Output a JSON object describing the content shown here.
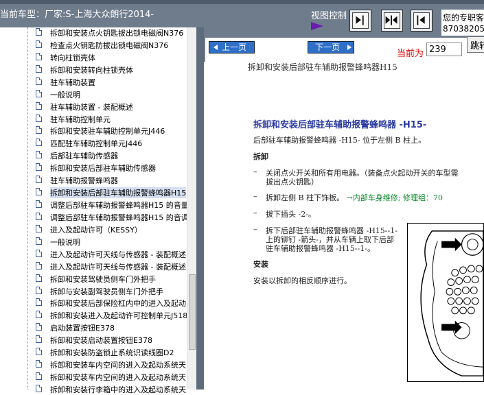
{
  "header": {
    "car_model": "当前车型：厂家:S-上海大众朗行2014-",
    "view_control": "视图控制",
    "shop_line1": "您的专职客",
    "shop_line2": "87038205"
  },
  "nav": {
    "prev": "上一页",
    "next": "下一页",
    "current_label": "当前为",
    "page_value": "239",
    "goto": "跳转"
  },
  "tree": {
    "items": [
      {
        "label": "拆卸和安装点火钥匙拔出锁电磁阀N376"
      },
      {
        "label": "检查点火钥匙防拔出锁电磁阀N376"
      },
      {
        "label": "转向柱锁壳体"
      },
      {
        "label": "拆卸和安装转向柱锁壳体"
      },
      {
        "label": "驻车辅助装置"
      },
      {
        "label": "一般说明"
      },
      {
        "label": "驻车辅助装置 - 装配概述"
      },
      {
        "label": "驻车辅助控制单元"
      },
      {
        "label": "拆卸和安装驻车辅助控制单元J446"
      },
      {
        "label": "匹配驻车辅助控制单元J446"
      },
      {
        "label": "后部驻车辅助传感器"
      },
      {
        "label": "拆卸和安装后部驻车辅助传感器"
      },
      {
        "label": "驻车辅助报警蜂鸣器"
      },
      {
        "label": "拆卸和安装后部驻车辅助报警蜂鸣器H15",
        "selected": true
      },
      {
        "label": "调整后部驻车辅助报警蜂鸣器H15 的音量"
      },
      {
        "label": "调整后部驻车辅助报警蜂鸣器H15 的音调"
      },
      {
        "label": "进入及起动许可（KESSY）"
      },
      {
        "label": "一般说明"
      },
      {
        "label": "进入及起动许可天线与传感器 - 装配概述"
      },
      {
        "label": "进入及起动许可天线与传感器 - 装配概述"
      },
      {
        "label": "拆卸和安装驾驶员侧车门外把手"
      },
      {
        "label": "拆卸与安装副驾驶员侧车门外把手"
      },
      {
        "label": "拆卸和安装后部保险杠内中的进入及起动"
      },
      {
        "label": "拆卸和安装进入及起动许可控制单元J518"
      },
      {
        "label": "启动装置按钮E378"
      },
      {
        "label": "拆卸和安装启动装置按钮E378"
      },
      {
        "label": "拆卸和安装防盗锁止系统识读线圈D2"
      },
      {
        "label": "拆卸和安装车内空间的进入及起动系统天"
      },
      {
        "label": "拆卸和安装车内空间的进入及起动系统天"
      },
      {
        "label": "拆卸和安装行李箱中的进入及起动系统天"
      }
    ]
  },
  "doc": {
    "header": "拆卸和安装后部驻车辅助报警蜂鸣器H15",
    "title": "拆卸和安装后部驻车辅助报警蜂鸣器 -H15-",
    "location": "后部驻车辅助报警蜂鸣器 -H15- 位于左侧 B 柱上。",
    "removal_heading": "拆卸",
    "step1_a": "关闭点火开关和所有用电器。（装备点火起动开关的车型需",
    "step1_b": "拔出点火钥匙）",
    "step2_text": "拆卸左侧 B 柱下饰板。",
    "step2_link": "→内部车身维修; 修理组：70",
    "step3": "拔下插头 -2-。",
    "step4_a": "拆下后部驻车辅助报警蜂鸣器 -H15--1-",
    "step4_b": "上的铆钉 -箭头-，并从车辆上取下后部",
    "step4_c": "驻车辅助报警蜂鸣器 -H15--1-。",
    "bullet": "–",
    "install_heading": "安装",
    "install_text": "安装以拆卸的相反顺序进行。"
  },
  "colors": {
    "topbar": "#6f7c8c",
    "title_blue": "#2a3aa0",
    "link_green": "#0a8a2a",
    "nav_button": "#2f6fc8",
    "current_label_red": "#e00000"
  }
}
